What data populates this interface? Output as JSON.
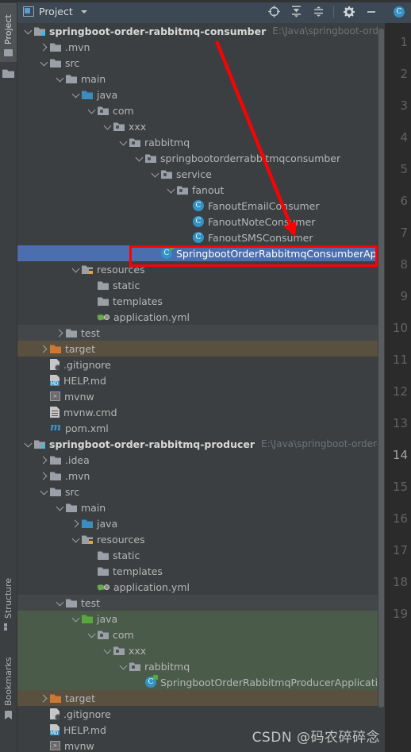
{
  "window": {
    "tool_window_title": "Project",
    "window_icon": "project-window-icon",
    "dropdown_icon": "chevron-down-icon",
    "actions": [
      {
        "name": "select-opened-file-icon",
        "label": "Select Opened File"
      },
      {
        "name": "expand-all-icon",
        "label": "Expand All"
      },
      {
        "name": "collapse-all-icon",
        "label": "Collapse All"
      },
      {
        "name": "settings-gear-icon",
        "label": "Options"
      },
      {
        "name": "hide-minimize-icon",
        "label": "Hide"
      }
    ]
  },
  "left_tool_tabs": [
    {
      "id": "project",
      "label": "Project",
      "icon": "project-tab-icon",
      "active": true
    },
    {
      "id": "structure",
      "label": "Structure",
      "icon": "structure-tab-icon",
      "active": false
    },
    {
      "id": "bookmarks",
      "label": "Bookmarks",
      "icon": "bookmark-tab-icon",
      "active": false
    }
  ],
  "tree": [
    {
      "indent": 0,
      "arrow": "down",
      "icon": "module-folder",
      "label": "springboot-order-rabbitmq-consumber",
      "bold": true,
      "path": "E:\\Java\\springboot-order-rabbit",
      "highlight": ""
    },
    {
      "indent": 1,
      "arrow": "right",
      "icon": "folder",
      "label": ".mvn",
      "bold": false,
      "path": "",
      "highlight": ""
    },
    {
      "indent": 1,
      "arrow": "down",
      "icon": "folder",
      "label": "src",
      "bold": false,
      "path": "",
      "highlight": ""
    },
    {
      "indent": 2,
      "arrow": "down",
      "icon": "folder",
      "label": "main",
      "bold": false,
      "path": "",
      "highlight": ""
    },
    {
      "indent": 3,
      "arrow": "down",
      "icon": "folder-blue",
      "label": "java",
      "bold": false,
      "path": "",
      "highlight": ""
    },
    {
      "indent": 4,
      "arrow": "down",
      "icon": "package",
      "label": "com",
      "bold": false,
      "path": "",
      "highlight": ""
    },
    {
      "indent": 5,
      "arrow": "down",
      "icon": "package",
      "label": "xxx",
      "bold": false,
      "path": "",
      "highlight": ""
    },
    {
      "indent": 6,
      "arrow": "down",
      "icon": "package",
      "label": "rabbitmq",
      "bold": false,
      "path": "",
      "highlight": ""
    },
    {
      "indent": 7,
      "arrow": "down",
      "icon": "package",
      "label": "springbootorderrabbitmqconsumber",
      "bold": false,
      "path": "",
      "highlight": ""
    },
    {
      "indent": 8,
      "arrow": "down",
      "icon": "package",
      "label": "service",
      "bold": false,
      "path": "",
      "highlight": ""
    },
    {
      "indent": 9,
      "arrow": "down",
      "icon": "package",
      "label": "fanout",
      "bold": false,
      "path": "",
      "highlight": ""
    },
    {
      "indent": 10,
      "arrow": "none",
      "icon": "class",
      "label": "FanoutEmailConsumer",
      "bold": false,
      "path": "",
      "highlight": ""
    },
    {
      "indent": 10,
      "arrow": "none",
      "icon": "class",
      "label": "FanoutNoteConsumer",
      "bold": false,
      "path": "",
      "highlight": ""
    },
    {
      "indent": 10,
      "arrow": "none",
      "icon": "class",
      "label": "FanoutSMSConsumer",
      "bold": false,
      "path": "",
      "highlight": ""
    },
    {
      "indent": 8,
      "arrow": "none",
      "icon": "runnable-class",
      "label": "SpringbootOrderRabbitmqConsumberApplication",
      "bold": false,
      "path": "",
      "highlight": "selected"
    },
    {
      "indent": 3,
      "arrow": "down",
      "icon": "resources",
      "label": "resources",
      "bold": false,
      "path": "",
      "highlight": ""
    },
    {
      "indent": 4,
      "arrow": "none",
      "icon": "folder",
      "label": "static",
      "bold": false,
      "path": "",
      "highlight": ""
    },
    {
      "indent": 4,
      "arrow": "none",
      "icon": "folder",
      "label": "templates",
      "bold": false,
      "path": "",
      "highlight": ""
    },
    {
      "indent": 4,
      "arrow": "none",
      "icon": "yaml-file",
      "label": "application.yml",
      "bold": false,
      "path": "",
      "highlight": ""
    },
    {
      "indent": 2,
      "arrow": "right",
      "icon": "folder",
      "label": "test",
      "bold": false,
      "path": "",
      "highlight": "dark"
    },
    {
      "indent": 1,
      "arrow": "right",
      "icon": "folder-orange",
      "label": "target",
      "bold": false,
      "path": "",
      "highlight": "brown"
    },
    {
      "indent": 1,
      "arrow": "none",
      "icon": "gitignore-file",
      "label": ".gitignore",
      "bold": false,
      "path": "",
      "highlight": ""
    },
    {
      "indent": 1,
      "arrow": "none",
      "icon": "markdown-file",
      "label": "HELP.md",
      "bold": false,
      "path": "",
      "highlight": ""
    },
    {
      "indent": 1,
      "arrow": "none",
      "icon": "shell-file",
      "label": "mvnw",
      "bold": false,
      "path": "",
      "highlight": ""
    },
    {
      "indent": 1,
      "arrow": "none",
      "icon": "cmd-file",
      "label": "mvnw.cmd",
      "bold": false,
      "path": "",
      "highlight": ""
    },
    {
      "indent": 1,
      "arrow": "none",
      "icon": "maven-file",
      "label": "pom.xml",
      "bold": false,
      "path": "",
      "highlight": ""
    },
    {
      "indent": 0,
      "arrow": "down",
      "icon": "module-folder",
      "label": "springboot-order-rabbitmq-producer",
      "bold": true,
      "path": "E:\\Java\\springboot-order-rabbitm",
      "highlight": ""
    },
    {
      "indent": 1,
      "arrow": "right",
      "icon": "folder",
      "label": ".idea",
      "bold": false,
      "path": "",
      "highlight": ""
    },
    {
      "indent": 1,
      "arrow": "right",
      "icon": "folder",
      "label": ".mvn",
      "bold": false,
      "path": "",
      "highlight": ""
    },
    {
      "indent": 1,
      "arrow": "down",
      "icon": "folder",
      "label": "src",
      "bold": false,
      "path": "",
      "highlight": ""
    },
    {
      "indent": 2,
      "arrow": "down",
      "icon": "folder",
      "label": "main",
      "bold": false,
      "path": "",
      "highlight": ""
    },
    {
      "indent": 3,
      "arrow": "right",
      "icon": "folder-blue",
      "label": "java",
      "bold": false,
      "path": "",
      "highlight": ""
    },
    {
      "indent": 3,
      "arrow": "down",
      "icon": "resources",
      "label": "resources",
      "bold": false,
      "path": "",
      "highlight": ""
    },
    {
      "indent": 4,
      "arrow": "none",
      "icon": "folder",
      "label": "static",
      "bold": false,
      "path": "",
      "highlight": ""
    },
    {
      "indent": 4,
      "arrow": "none",
      "icon": "folder",
      "label": "templates",
      "bold": false,
      "path": "",
      "highlight": ""
    },
    {
      "indent": 4,
      "arrow": "none",
      "icon": "yaml-file",
      "label": "application.yml",
      "bold": false,
      "path": "",
      "highlight": ""
    },
    {
      "indent": 2,
      "arrow": "down",
      "icon": "folder",
      "label": "test",
      "bold": false,
      "path": "",
      "highlight": "dark"
    },
    {
      "indent": 3,
      "arrow": "down",
      "icon": "folder-green",
      "label": "java",
      "bold": false,
      "path": "",
      "highlight": "green"
    },
    {
      "indent": 4,
      "arrow": "down",
      "icon": "package",
      "label": "com",
      "bold": false,
      "path": "",
      "highlight": "green"
    },
    {
      "indent": 5,
      "arrow": "down",
      "icon": "package",
      "label": "xxx",
      "bold": false,
      "path": "",
      "highlight": "green"
    },
    {
      "indent": 6,
      "arrow": "down",
      "icon": "package",
      "label": "rabbitmq",
      "bold": false,
      "path": "",
      "highlight": "green"
    },
    {
      "indent": 7,
      "arrow": "none",
      "icon": "test-class",
      "label": "SpringbootOrderRabbitmqProducerApplicationTests",
      "bold": false,
      "path": "",
      "highlight": "green"
    },
    {
      "indent": 1,
      "arrow": "right",
      "icon": "folder-orange",
      "label": "target",
      "bold": false,
      "path": "",
      "highlight": "brown"
    },
    {
      "indent": 1,
      "arrow": "none",
      "icon": "gitignore-file",
      "label": ".gitignore",
      "bold": false,
      "path": "",
      "highlight": ""
    },
    {
      "indent": 1,
      "arrow": "none",
      "icon": "markdown-file",
      "label": "HELP.md",
      "bold": false,
      "path": "",
      "highlight": ""
    },
    {
      "indent": 1,
      "arrow": "none",
      "icon": "shell-file",
      "label": "mvnw",
      "bold": false,
      "path": "",
      "highlight": ""
    }
  ],
  "editor_gutter": {
    "tab_icon": "java-class-tab-icon",
    "line_numbers": [
      "1",
      "2",
      "3",
      "4",
      "5",
      "6",
      "7",
      "8",
      "9",
      "10",
      "11",
      "12",
      "13",
      "14",
      "15",
      "16",
      "17",
      "18",
      "19"
    ],
    "current_line": "14"
  },
  "annotations": {
    "arrow_color": "#ff0000",
    "box_color": "#ff0000",
    "arrow_label": "red-pointer-arrow",
    "box_label": "red-highlight-box"
  },
  "watermark": {
    "text": "CSDN @码农碎碎念"
  },
  "colors": {
    "panel_bg": "#3c3f41",
    "header_bg": "#3c4853",
    "selection": "#4b6eaf",
    "test_scope_green": "#4a5c49",
    "excluded_brown": "#5a5040",
    "accent_blue": "#3592c4",
    "annotation_red": "#ff0000"
  }
}
